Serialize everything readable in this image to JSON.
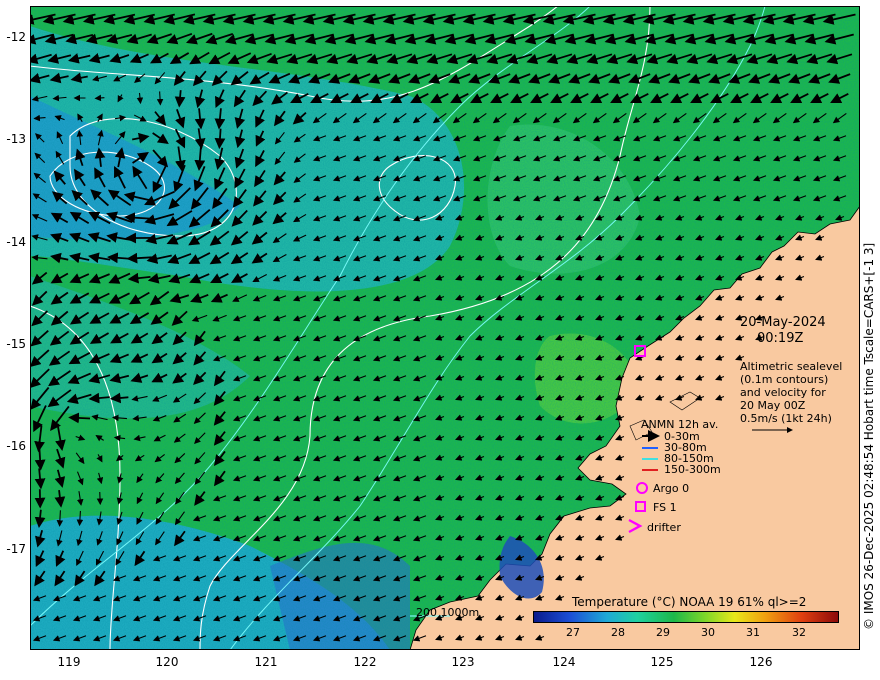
{
  "map": {
    "y_ticks": [
      "-12",
      "-13",
      "-14",
      "-15",
      "-16",
      "-17"
    ],
    "x_ticks": [
      "119",
      "120",
      "121",
      "122",
      "123",
      "124",
      "125",
      "126"
    ],
    "lon_range": [
      118.6,
      126.9
    ],
    "lat_range": [
      -17.95,
      -11.68
    ]
  },
  "side_text": "© IMOS 26-Dec-2025 02:48:54 Hobart time Tscale=CARS+[-1 3]",
  "date_block": {
    "date": "20-May-2024",
    "time": "00:19Z"
  },
  "altimetry_block": {
    "lines": [
      "Altimetric sealevel",
      "(0.1m contours)",
      "and velocity for",
      "20 May 00Z",
      "0.5m/s (1kt 24h)"
    ]
  },
  "legend": {
    "title": "ANMN 12h av.",
    "items": [
      {
        "label": "0-30m",
        "color": "#000000"
      },
      {
        "label": "30-80m",
        "color": "#2060ff"
      },
      {
        "label": "80-150m",
        "color": "#40e0e0"
      },
      {
        "label": "150-300m",
        "color": "#e02020"
      }
    ],
    "symbols": [
      {
        "label": "Argo 0",
        "shape": "circle",
        "color": "#ff00ff"
      },
      {
        "label": "FS 1",
        "shape": "square",
        "color": "#ff00ff"
      },
      {
        "label": "drifter",
        "shape": "chevron",
        "color": "#ff00ff"
      }
    ]
  },
  "bathy_label": "200  1000m",
  "colorbar": {
    "title": "Temperature (°C) NOAA 19 61% ql>=2",
    "ticks": [
      "27",
      "28",
      "29",
      "30",
      "31",
      "32"
    ],
    "range": [
      26.1,
      32.9
    ]
  },
  "colors": {
    "land": "#f9c9a0",
    "ocean_warm": "#1fbf3a",
    "ocean_cool": "#1ea7d8",
    "contour": "#ffffff",
    "isobath": "#7fffff"
  }
}
